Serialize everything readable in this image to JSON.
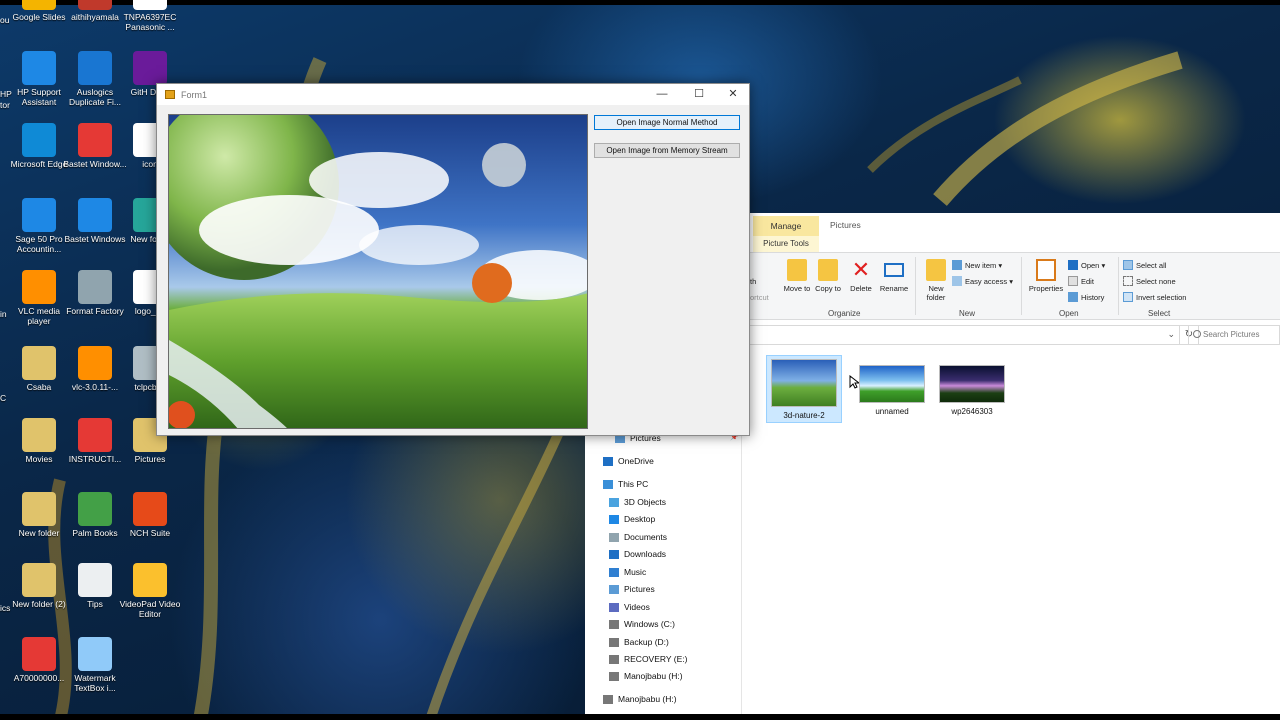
{
  "desktop": {
    "icons": [
      {
        "label": "Google Slides",
        "color": "#f4b400"
      },
      {
        "label": "aithihyamala",
        "color": "#c0392b"
      },
      {
        "label": "TNPA6397EC Panasonic ...",
        "color": "#ffffff"
      },
      {
        "label": "HP Support Assistant",
        "color": "#1e88e5"
      },
      {
        "label": "Auslogics Duplicate Fi...",
        "color": "#1976d2"
      },
      {
        "label": "GitH Desk",
        "color": "#6a1b9a"
      },
      {
        "label": "Microsoft Edge",
        "color": "#0f8ad6"
      },
      {
        "label": "Bastet Window...",
        "color": "#e53935"
      },
      {
        "label": "icon",
        "color": "#ffffff"
      },
      {
        "label": "Sage 50 Pro Accountin...",
        "color": "#1e88e5"
      },
      {
        "label": "Bastet Windows",
        "color": "#1e88e5"
      },
      {
        "label": "New fo (4)",
        "color": "#26a69a"
      },
      {
        "label": "VLC media player",
        "color": "#ff8f00"
      },
      {
        "label": "Format Factory",
        "color": "#90a4ae"
      },
      {
        "label": "logo_20",
        "color": "#ffffff"
      },
      {
        "label": "Csaba",
        "color": "#e0c36b"
      },
      {
        "label": "vlc-3.0.11-...",
        "color": "#ff8f00"
      },
      {
        "label": "tclpcb_s",
        "color": "#b0bec5"
      },
      {
        "label": "Movies",
        "color": "#e0c36b"
      },
      {
        "label": "INSTRUCTI...",
        "color": "#e53935"
      },
      {
        "label": "Pictures",
        "color": "#e0c36b"
      },
      {
        "label": "New folder",
        "color": "#e0c36b"
      },
      {
        "label": "Palm Books",
        "color": "#43a047"
      },
      {
        "label": "NCH Suite",
        "color": "#e64a19"
      },
      {
        "label": "New folder (2)",
        "color": "#e0c36b"
      },
      {
        "label": "Tips",
        "color": "#eceff1"
      },
      {
        "label": "VideoPad Video Editor",
        "color": "#fbc02d"
      },
      {
        "label": "A70000000...",
        "color": "#e53935"
      },
      {
        "label": "Watermark TextBox i...",
        "color": "#90caf9"
      }
    ],
    "edge_labels": [
      "ou",
      "HP",
      "tor",
      "in",
      "C",
      "ics"
    ]
  },
  "form1": {
    "title": "Form1",
    "minimize": "—",
    "maximize": "☐",
    "close": "✕",
    "btn_normal": "Open Image Normal Method",
    "btn_stream": "Open Image from Memory Stream"
  },
  "explorer": {
    "tabs": {
      "manage": "Manage",
      "picture_tools": "Picture Tools",
      "pictures": "Pictures"
    },
    "ribbon": {
      "partial_left_1": "th",
      "partial_left_2": "ortcut",
      "move_to": "Move to",
      "copy_to": "Copy to",
      "delete": "Delete",
      "rename": "Rename",
      "organize": "Organize",
      "new_folder": "New folder",
      "new_item": "New item",
      "easy_access": "Easy access",
      "new": "New",
      "properties": "Properties",
      "open": "Open",
      "edit": "Edit",
      "history": "History",
      "open_group": "Open",
      "select_all": "Select all",
      "select_none": "Select none",
      "invert_selection": "Invert selection",
      "select_group": "Select"
    },
    "search_placeholder": "Search Pictures",
    "nav": [
      {
        "label": "Pictures",
        "icon": "pictures-icon"
      },
      {
        "label": "OneDrive",
        "icon": "onedrive-icon"
      },
      {
        "label": "This PC",
        "icon": "pc-icon"
      },
      {
        "label": "3D Objects",
        "icon": "3d-icon"
      },
      {
        "label": "Desktop",
        "icon": "desktop-icon"
      },
      {
        "label": "Documents",
        "icon": "documents-icon"
      },
      {
        "label": "Downloads",
        "icon": "downloads-icon"
      },
      {
        "label": "Music",
        "icon": "music-icon"
      },
      {
        "label": "Pictures",
        "icon": "pictures-icon"
      },
      {
        "label": "Videos",
        "icon": "videos-icon"
      },
      {
        "label": "Windows (C:)",
        "icon": "drive-icon"
      },
      {
        "label": "Backup (D:)",
        "icon": "drive-icon"
      },
      {
        "label": "RECOVERY (E:)",
        "icon": "drive-icon"
      },
      {
        "label": "Manojbabu (H:)",
        "icon": "drive-icon"
      },
      {
        "label": "Manojbabu (H:)",
        "icon": "drive-icon"
      }
    ],
    "files": [
      {
        "name": "3d-nature-2",
        "selected": true
      },
      {
        "name": "unnamed",
        "selected": false
      },
      {
        "name": "wp2646303",
        "selected": false
      }
    ]
  }
}
